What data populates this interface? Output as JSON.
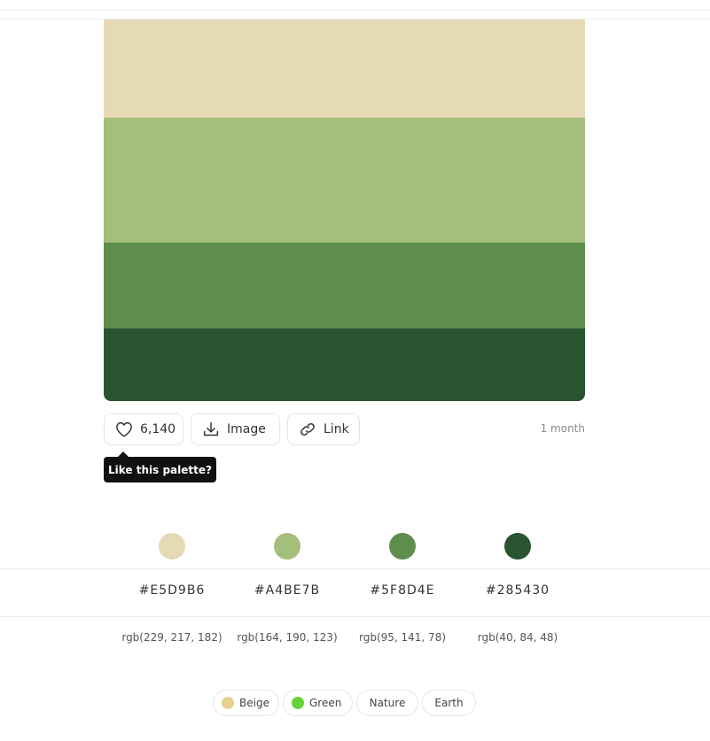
{
  "palette": {
    "colors": [
      "#E5D9B6",
      "#A4BE7B",
      "#5F8D4E",
      "#285430"
    ],
    "hex": [
      "#E5D9B6",
      "#A4BE7B",
      "#5F8D4E",
      "#285430"
    ],
    "rgb": [
      "rgb(229, 217, 182)",
      "rgb(164, 190, 123)",
      "rgb(95, 141, 78)",
      "rgb(40, 84, 48)"
    ]
  },
  "actions": {
    "likes": "6,140",
    "image_label": "Image",
    "link_label": "Link",
    "age": "1 month"
  },
  "tooltip": {
    "text": "Like this palette?"
  },
  "tags": [
    {
      "label": "Beige",
      "color": "#E9CF8F"
    },
    {
      "label": "Green",
      "color": "#67D23A"
    },
    {
      "label": "Nature"
    },
    {
      "label": "Earth"
    }
  ],
  "icons": {
    "like": "heart-icon",
    "image": "download-icon",
    "link": "link-icon"
  }
}
